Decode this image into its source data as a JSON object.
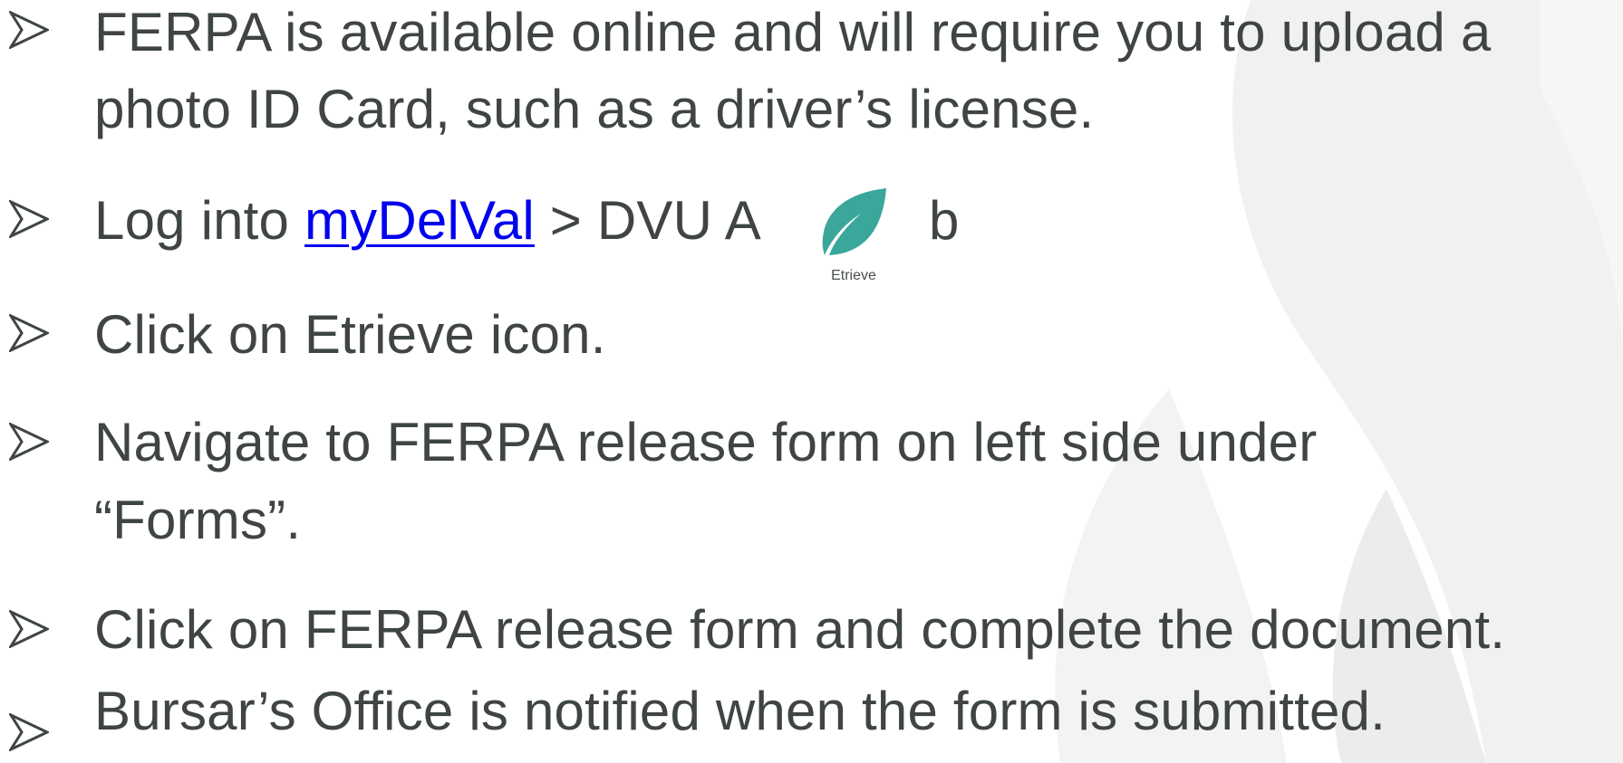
{
  "bullets": [
    {
      "line1": "FERPA is available online and will require you to upload a",
      "line2": "photo ID Card, such as a driver’s license."
    },
    {
      "prefix": "Log into ",
      "link_text": "myDelVal",
      "middle": " > DVU A",
      "suffix": "b",
      "app_icon": {
        "icon": "leaf-icon",
        "label": "Etrieve",
        "color": "#3aa79a"
      }
    },
    {
      "line1": "Click on Etrieve icon."
    },
    {
      "line1": "Navigate to FERPA release form on left side under",
      "line2": "“Forms”."
    },
    {
      "line1": "Click on FERPA release form and complete the document."
    },
    {
      "line1": "Bursar’s Office is notified when the form is submitted."
    }
  ],
  "colors": {
    "text": "#3f4444",
    "link": "#0000ee",
    "accent": "#3aa79a"
  }
}
